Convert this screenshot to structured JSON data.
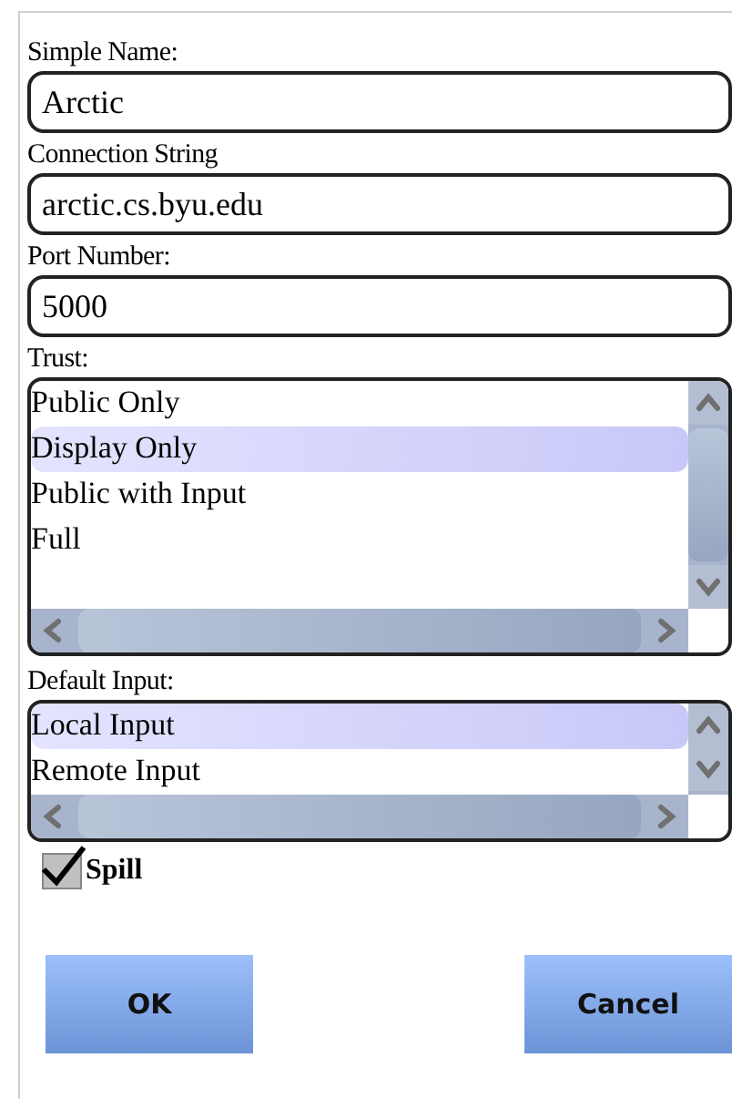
{
  "fields": [
    {
      "label": "Simple Name:",
      "value": "Arctic"
    },
    {
      "label": "Connection String",
      "value": "arctic.cs.byu.edu"
    },
    {
      "label": "Port Number:",
      "value": "5000"
    }
  ],
  "lists": [
    {
      "label": "Trust:",
      "items": [
        {
          "text": "Public Only",
          "selected": false
        },
        {
          "text": "Display Only",
          "selected": true
        },
        {
          "text": "Public with Input",
          "selected": false
        },
        {
          "text": "Full",
          "selected": false
        }
      ]
    },
    {
      "label": "Default Input:",
      "items": [
        {
          "text": "Local Input",
          "selected": true
        },
        {
          "text": "Remote Input",
          "selected": false
        }
      ]
    }
  ],
  "spill": {
    "label": "Spill",
    "checked": true
  },
  "buttons": [
    "OK",
    "Cancel"
  ]
}
